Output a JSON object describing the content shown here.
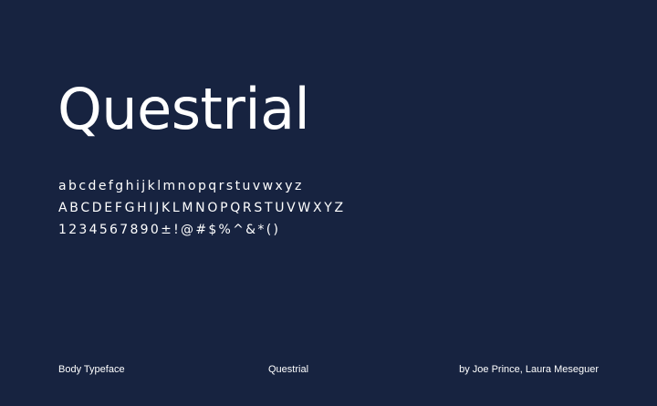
{
  "specimen": {
    "title": "Questrial",
    "lowercase": "abcdefghijklmnopqrstuvwxyz",
    "uppercase": "ABCDEFGHIJKLMNOPQRSTUVWXYZ",
    "numbers_symbols": "1234567890±!@#$%^&*()"
  },
  "footer": {
    "category": "Body Typeface",
    "font_name": "Questrial",
    "credits": "by Joe Prince, Laura Meseguer"
  },
  "colors": {
    "background": "#172340",
    "text": "#ffffff"
  }
}
